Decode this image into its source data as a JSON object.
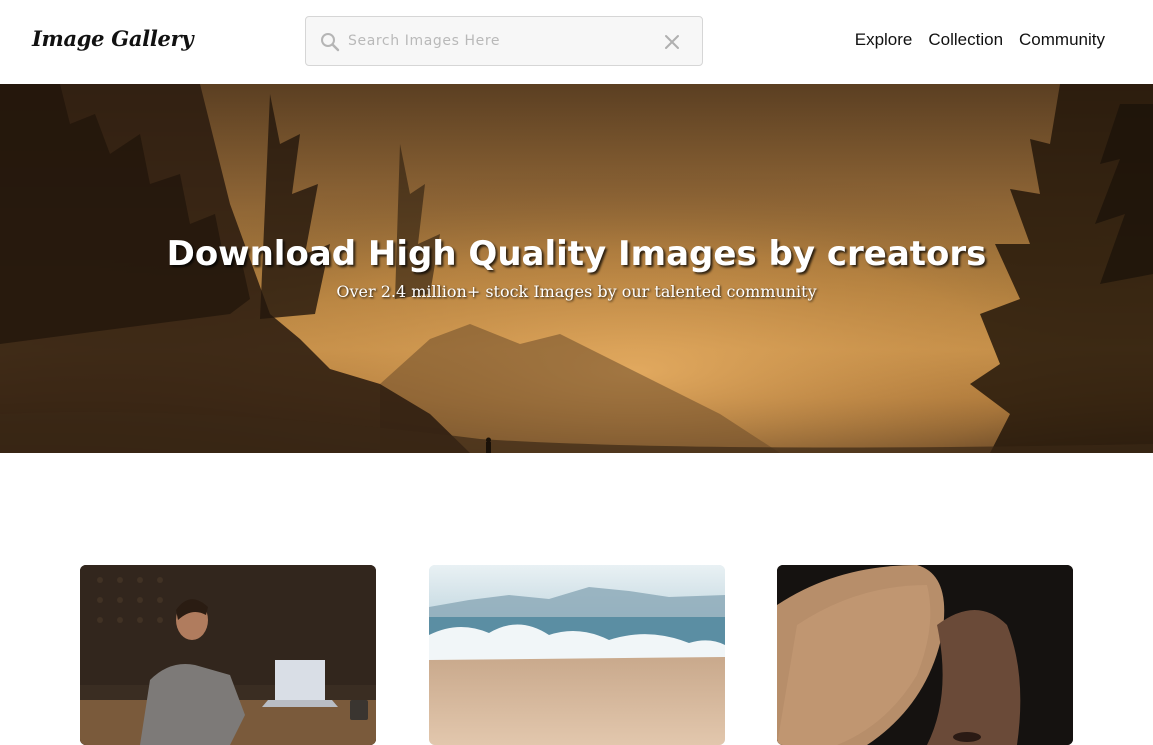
{
  "navbar": {
    "logo": "Image Gallery",
    "search": {
      "placeholder": "Search Images Here",
      "value": "",
      "icon": "search-icon",
      "clear_icon": "close-icon"
    },
    "links": [
      {
        "label": "Explore"
      },
      {
        "label": "Collection"
      },
      {
        "label": "Community"
      }
    ]
  },
  "hero": {
    "title": "Download High Quality Images by creators",
    "subtitle": "Over 2.4 million+ stock Images by our talented community"
  },
  "gallery": {
    "items": [
      {
        "subject": "man working on laptop"
      },
      {
        "subject": "ocean waves on beach"
      },
      {
        "subject": "woman with hat"
      }
    ]
  }
}
